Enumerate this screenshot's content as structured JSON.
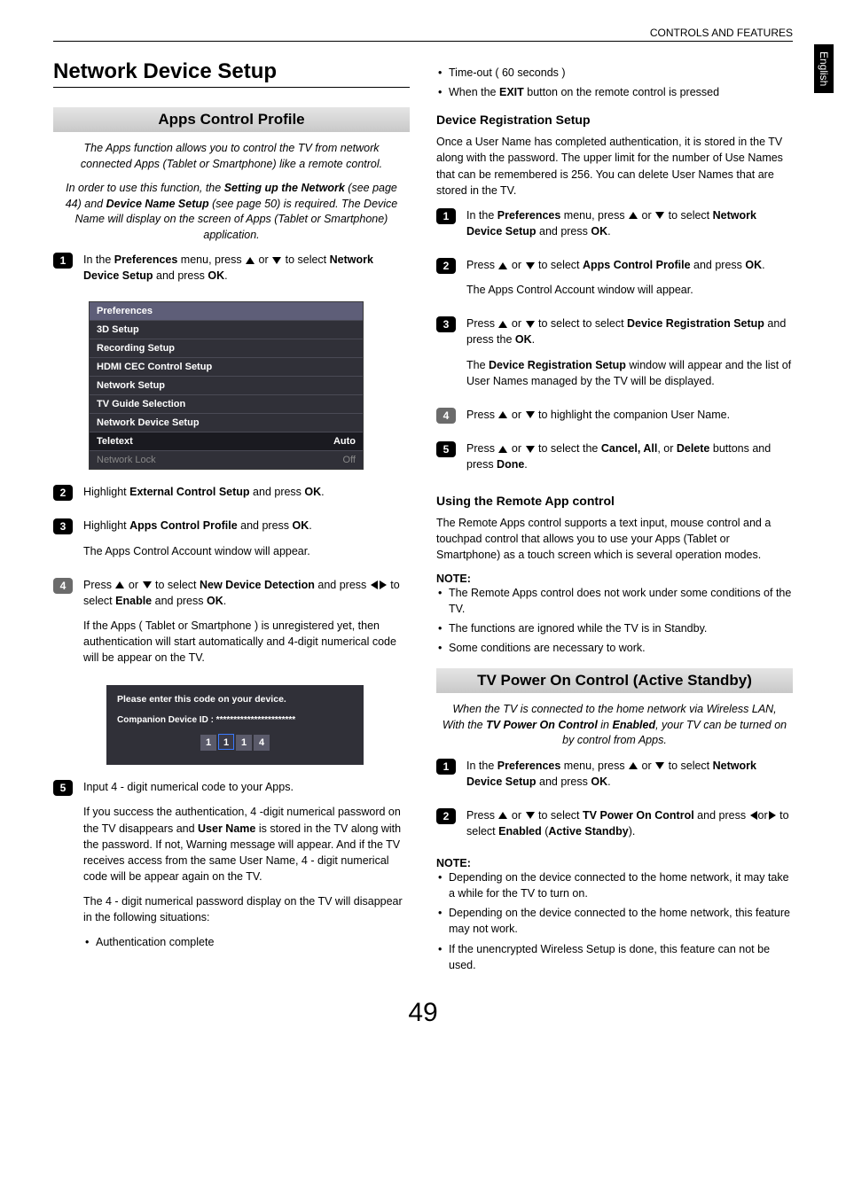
{
  "header": {
    "section": "CONTROLS AND FEATURES",
    "language_tab": "English"
  },
  "page_number": "49",
  "left": {
    "title": "Network Device Setup",
    "section1": {
      "banner": "Apps Control Profile",
      "intro1": "The Apps function allows you to control the TV from network connected Apps (Tablet or Smartphone) like a remote control.",
      "intro2_a": "In order to use this function, the ",
      "intro2_b": "Setting up the Network",
      "intro2_c": " (see page 44) and ",
      "intro2_d": "Device Name Setup",
      "intro2_e": " (see page 50) is required. The Device Name will display on the screen of Apps (Tablet or Smartphone) application.",
      "step1_a": "In the ",
      "step1_b": "Preferences",
      "step1_c": " menu, press ",
      "step1_d": " or ",
      "step1_e": " to select ",
      "step1_f": "Network Device Setup",
      "step1_g": " and press ",
      "step1_h": "OK",
      "step1_i": ".",
      "menu": {
        "header": "Preferences",
        "rows": [
          {
            "label": "3D Setup",
            "value": ""
          },
          {
            "label": "Recording Setup",
            "value": ""
          },
          {
            "label": "HDMI CEC Control Setup",
            "value": ""
          },
          {
            "label": "Network Setup",
            "value": ""
          },
          {
            "label": "TV Guide Selection",
            "value": ""
          },
          {
            "label": "Network Device Setup",
            "value": ""
          },
          {
            "label": "Teletext",
            "value": "Auto"
          },
          {
            "label": "Network Lock",
            "value": "Off"
          }
        ]
      },
      "step2_a": "Highlight ",
      "step2_b": "External Control Setup",
      "step2_c": " and press ",
      "step2_d": "OK",
      "step2_e": ".",
      "step3_a": "Highlight ",
      "step3_b": "Apps Control Profile",
      "step3_c": " and press ",
      "step3_d": "OK",
      "step3_e": ".",
      "step3_f": "The Apps Control Account window will appear.",
      "step4_a": "Press ",
      "step4_b": " or ",
      "step4_c": " to select ",
      "step4_d": "New Device Detection",
      "step4_e": " and press ",
      "step4_f": " to select ",
      "step4_g": "Enable",
      "step4_h": "  and press ",
      "step4_i": "OK",
      "step4_j": ".",
      "step4_k": "If the Apps ( Tablet or Smartphone ) is unregistered yet, then authentication will start automatically and 4-digit numerical code will be appear on the TV.",
      "code_mock": {
        "line1": "Please enter this code on your device.",
        "line2": "Companion Device ID : ***********************",
        "digits": [
          "1",
          "1",
          "1",
          "4"
        ]
      },
      "step5_a": "Input 4 - digit numerical code to your Apps.",
      "step5_b1": "If you success the authentication, 4 -digit numerical password on the TV disappears and ",
      "step5_b2": "User Name",
      "step5_b3": " is stored in the TV along with the password. If not, Warning message will appear. And if the TV receives access from the same User Name, 4 - digit numerical code will be appear again on the TV.",
      "step5_c": "The 4 - digit numerical password display on the TV will disappear in the following situations:",
      "step5_bullet1": "Authentication complete"
    }
  },
  "right": {
    "top_bullets": {
      "b1": "Time-out ( 60 seconds )",
      "b2_a": "When the ",
      "b2_b": "EXIT",
      "b2_c": " button on the remote control is pressed"
    },
    "drs": {
      "heading": "Device Registration Setup",
      "intro": "Once a User Name has completed authentication, it is stored in the TV along with the password. The upper limit for the number of Use Names that can be remembered is 256. You can delete User Names that are stored in the TV.",
      "s1_a": "In the ",
      "s1_b": "Preferences",
      "s1_c": " menu, press ",
      "s1_d": " or ",
      "s1_e": " to select ",
      "s1_f": "Network Device Setup",
      "s1_g": " and press ",
      "s1_h": "OK",
      "s1_i": ".",
      "s2_a": "Press ",
      "s2_b": " or ",
      "s2_c": " to select ",
      "s2_d": "Apps Control Profile",
      "s2_e": " and press ",
      "s2_f": "OK",
      "s2_g": ".",
      "s2_h": "The Apps Control Account window will appear.",
      "s3_a": "Press ",
      "s3_b": " or ",
      "s3_c": " to select to select ",
      "s3_d": "Device Registration Setup",
      "s3_e": " and press the ",
      "s3_f": "OK",
      "s3_g": ".",
      "s3_h": "The ",
      "s3_i": "Device Registration Setup",
      "s3_j": " window will appear and the list of User Names managed by the TV will be displayed.",
      "s4_a": "Press ",
      "s4_b": " or ",
      "s4_c": " to highlight the companion User Name.",
      "s5_a": "Press ",
      "s5_b": " or ",
      "s5_c": " to select the ",
      "s5_d": "Cancel, All",
      "s5_e": ", or ",
      "s5_f": "Delete",
      "s5_g": " buttons and press ",
      "s5_h": "Done",
      "s5_i": "."
    },
    "remote_app": {
      "heading": "Using the Remote App control",
      "p1": "The Remote Apps control supports a text input, mouse control and a touchpad control that allows you to use your Apps (Tablet or Smartphone) as a touch screen which is several operation modes.",
      "note_label": "NOTE:",
      "n1": "The Remote Apps control does not work under some conditions of the TV.",
      "n2": "The functions are ignored while the TV is in Standby.",
      "n3": "Some conditions are necessary to work."
    },
    "power": {
      "banner": "TV Power On Control (Active Standby)",
      "intro_a": "When the TV is connected to the home network via Wireless LAN, With the ",
      "intro_b": "TV Power On Control",
      "intro_c": " in ",
      "intro_d": "Enabled",
      "intro_e": ", your TV can be turned on by control from Apps.",
      "s1_a": "In the ",
      "s1_b": "Preferences",
      "s1_c": " menu, press ",
      "s1_d": " or ",
      "s1_e": " to select ",
      "s1_f": "Network Device Setup",
      "s1_g": " and press ",
      "s1_h": "OK",
      "s1_i": ".",
      "s2_a": "Press ",
      "s2_b": " or ",
      "s2_c": " to select ",
      "s2_d": "TV Power On Control",
      "s2_e": " and press ",
      "s2_f": "or",
      "s2_g": " to select ",
      "s2_h": "Enabled",
      "s2_i": " (",
      "s2_j": "Active Standby",
      "s2_k": ").",
      "note_label": "NOTE:",
      "n1": "Depending on the device connected to the home network, it may take a while for the TV to turn on.",
      "n2": "Depending on the device connected to the home network, this feature may not work.",
      "n3": "If the unencrypted Wireless Setup is done, this feature can not be used."
    }
  }
}
